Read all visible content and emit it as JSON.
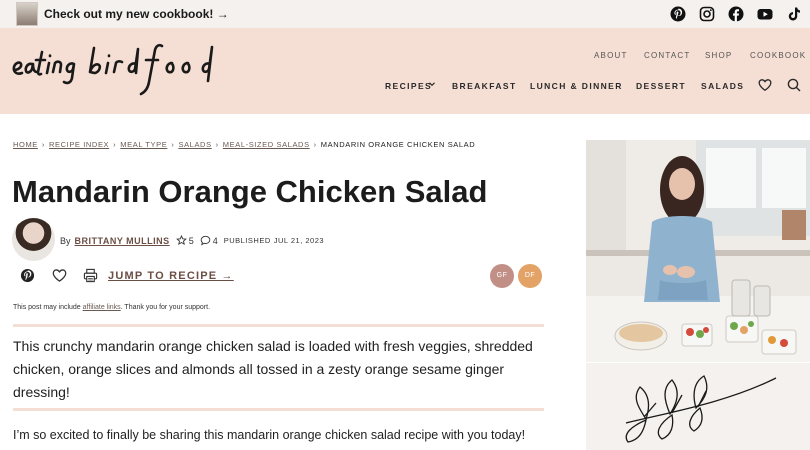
{
  "topbar": {
    "promo_text": "Check out my new cookbook! →",
    "social_icons": [
      "pinterest-icon",
      "instagram-icon",
      "facebook-icon",
      "youtube-icon",
      "tiktok-icon"
    ]
  },
  "header": {
    "logo_text": "eating bird food",
    "utility_links": [
      "ABOUT",
      "CONTACT",
      "SHOP",
      "COOKBOOK"
    ],
    "nav_items": [
      "RECIPES",
      "BREAKFAST",
      "LUNCH & DINNER",
      "DESSERT",
      "SALADS"
    ],
    "icons": [
      "heart-icon",
      "search-icon"
    ]
  },
  "breadcrumb": {
    "links": [
      "HOME",
      "RECIPE INDEX",
      "MEAL TYPE",
      "SALADS",
      "MEAL-SIZED SALADS"
    ],
    "current": "MANDARIN ORANGE CHICKEN SALAD"
  },
  "article": {
    "title": "Mandarin Orange Chicken Salad",
    "by_label": "By",
    "author": "BRITTANY MULLINS",
    "rating_count": "5",
    "comment_count": "4",
    "published_label": "PUBLISHED",
    "published_date": "JUL 21, 2023",
    "jump_label": "JUMP TO RECIPE →",
    "diet_badges": [
      {
        "label": "GF",
        "color": "#c28f86"
      },
      {
        "label": "DF",
        "color": "#e3a266"
      }
    ],
    "disclosure_prefix": "This post may include ",
    "disclosure_link": "affiliate links",
    "disclosure_suffix": ". Thank you for your support.",
    "intro": "This crunchy mandarin orange chicken salad is loaded with fresh veggies, shredded chicken, orange slices and almonds all tossed in a zesty orange sesame ginger dressing!",
    "first_paragraph": "I’m so excited to finally be sharing this mandarin orange chicken salad recipe with you today!"
  },
  "colors": {
    "header_bg": "#f5ded3",
    "accent_brown": "#6b4e44",
    "topbar_bg": "#f4f1ee"
  }
}
